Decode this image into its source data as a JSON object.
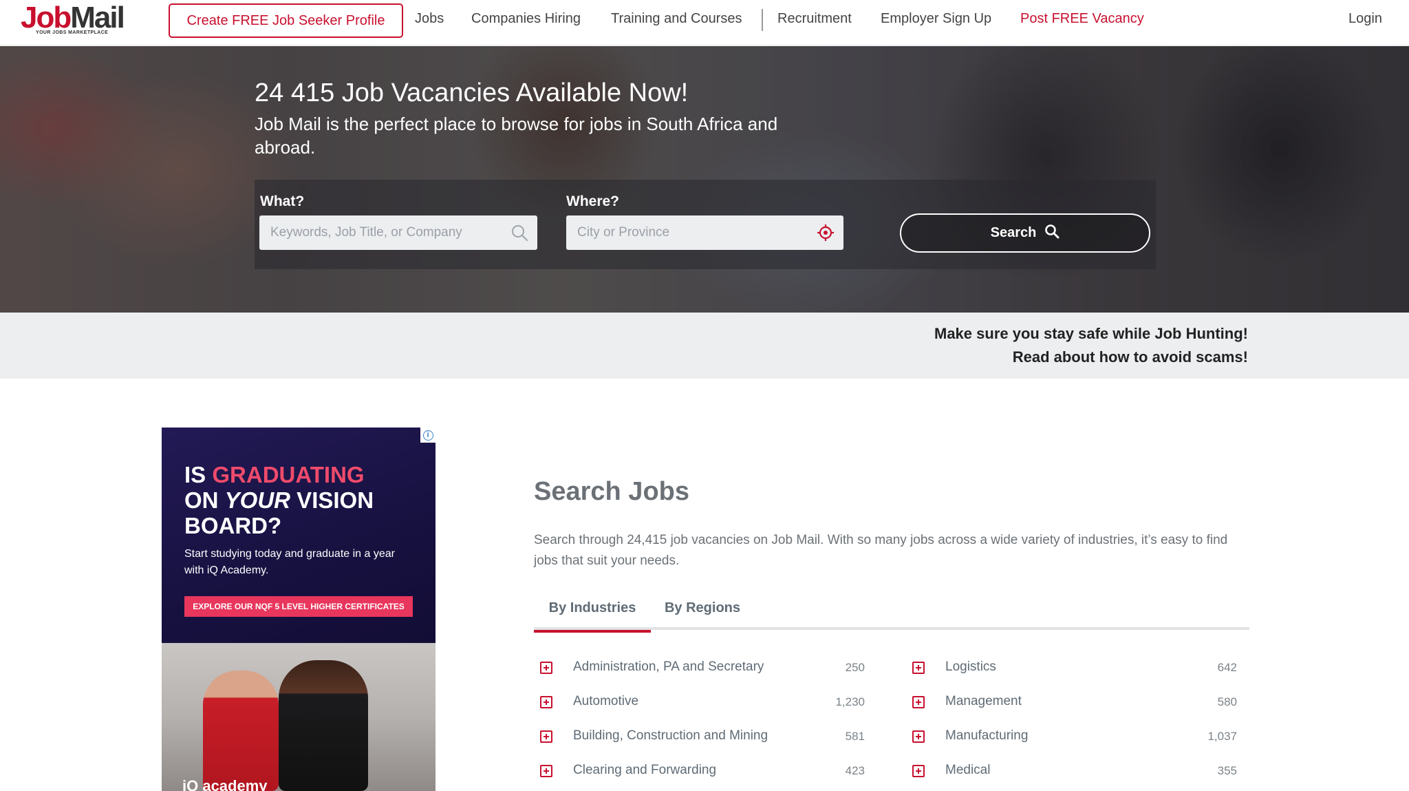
{
  "brand": {
    "logo_job": "Job",
    "logo_mail": "Mail",
    "tagline": "YOUR JOBS MARKETPLACE",
    "accent_color": "#c8102e"
  },
  "nav": {
    "cta": "Create FREE Job Seeker Profile",
    "items": [
      "Jobs",
      "Companies Hiring",
      "Training and Courses",
      "Recruitment",
      "Employer Sign Up"
    ],
    "post_vacancy": "Post FREE Vacancy",
    "login": "Login"
  },
  "hero": {
    "title": "24 415 Job Vacancies Available Now!",
    "subtitle": "Job Mail is the perfect place to browse for jobs in South Africa and abroad.",
    "what_label": "What?",
    "what_placeholder": "Keywords, Job Title, or Company",
    "where_label": "Where?",
    "where_placeholder": "City or Province",
    "search_button": "Search"
  },
  "safety": {
    "line1": "Make sure you stay safe while Job Hunting!",
    "line2": "Read about how to avoid scams!"
  },
  "ad": {
    "headline_1": "IS ",
    "headline_highlight": "GRADUATING",
    "headline_2": "ON ",
    "headline_italic": "YOUR",
    "headline_3": " VISION",
    "headline_4": "BOARD?",
    "body": "Start studying today and graduate in a year with iQ Academy.",
    "cta": "EXPLORE OUR NQF 5 LEVEL HIGHER CERTIFICATES",
    "brand": "iQ academy",
    "info_icon": "info-icon"
  },
  "search_jobs": {
    "title": "Search Jobs",
    "description": "Search through 24,415 job vacancies on Job Mail. With so many jobs across a wide variety of industries, it’s easy to find jobs that suit your needs.",
    "tabs": [
      "By Industries",
      "By Regions"
    ],
    "active_tab": "By Industries",
    "industries_left": [
      {
        "name": "Administration, PA and Secretary",
        "count": "250"
      },
      {
        "name": "Automotive",
        "count": "1,230"
      },
      {
        "name": "Building, Construction and Mining",
        "count": "581"
      },
      {
        "name": "Clearing and Forwarding",
        "count": "423"
      }
    ],
    "industries_right": [
      {
        "name": "Logistics",
        "count": "642"
      },
      {
        "name": "Management",
        "count": "580"
      },
      {
        "name": "Manufacturing",
        "count": "1,037"
      },
      {
        "name": "Medical",
        "count": "355"
      }
    ]
  }
}
